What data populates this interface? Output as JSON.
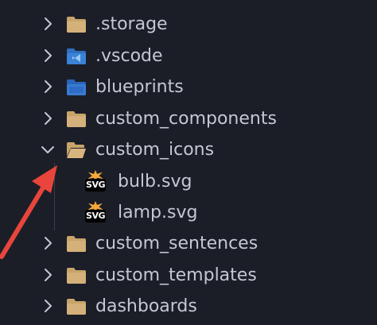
{
  "explorer": {
    "items": [
      {
        "label": ".storage",
        "type": "folder",
        "expanded": false,
        "icon": "folder-icon",
        "level": 0
      },
      {
        "label": ".vscode",
        "type": "folder",
        "expanded": false,
        "icon": "vscode-folder-icon",
        "level": 0
      },
      {
        "label": "blueprints",
        "type": "folder",
        "expanded": false,
        "icon": "blueprints-folder-icon",
        "level": 0
      },
      {
        "label": "custom_components",
        "type": "folder",
        "expanded": false,
        "icon": "folder-icon",
        "level": 0
      },
      {
        "label": "custom_icons",
        "type": "folder",
        "expanded": true,
        "icon": "folder-open-icon",
        "level": 0
      },
      {
        "label": "bulb.svg",
        "type": "file",
        "icon": "svg-file-icon",
        "badge": "SVG",
        "level": 1
      },
      {
        "label": "lamp.svg",
        "type": "file",
        "icon": "svg-file-icon",
        "badge": "SVG",
        "level": 1
      },
      {
        "label": "custom_sentences",
        "type": "folder",
        "expanded": false,
        "icon": "folder-icon",
        "level": 0
      },
      {
        "label": "custom_templates",
        "type": "folder",
        "expanded": false,
        "icon": "folder-icon",
        "level": 0
      },
      {
        "label": "dashboards",
        "type": "folder",
        "expanded": false,
        "icon": "folder-icon",
        "level": 0
      }
    ]
  },
  "colors": {
    "background": "#1b1e27",
    "text": "#c3c8d4",
    "folder": "#c8a46a",
    "vscode_folder": "#3b82d6",
    "arrow": "#e8453c"
  }
}
